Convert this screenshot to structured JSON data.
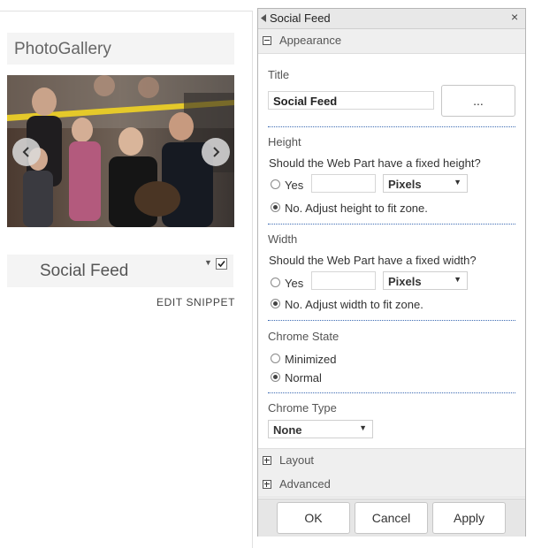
{
  "left": {
    "photo_gallery_title": "PhotoGallery",
    "social_feed_label": "Social Feed",
    "edit_snippet_label": "EDIT SNIPPET"
  },
  "panel": {
    "title": "Social Feed",
    "close_glyph": "×",
    "appearance_label": "Appearance",
    "title_field": {
      "label": "Title",
      "value": "Social Feed",
      "browse_button": "..."
    },
    "height": {
      "label": "Height",
      "question": "Should the Web Part have a fixed height?",
      "yes_label": "Yes",
      "unit": "Pixels",
      "no_label": "No. Adjust height to fit zone.",
      "selected": "no"
    },
    "width": {
      "label": "Width",
      "question": "Should the Web Part have a fixed width?",
      "yes_label": "Yes",
      "unit": "Pixels",
      "no_label": "No. Adjust width to fit zone.",
      "selected": "no"
    },
    "chrome_state": {
      "label": "Chrome State",
      "minimized_label": "Minimized",
      "normal_label": "Normal",
      "selected": "normal"
    },
    "chrome_type": {
      "label": "Chrome Type",
      "value": "None"
    },
    "layout_label": "Layout",
    "advanced_label": "Advanced",
    "buttons": {
      "ok": "OK",
      "cancel": "Cancel",
      "apply": "Apply"
    }
  },
  "icons": {
    "carousel_prev": "chevron-left-icon",
    "carousel_next": "chevron-right-icon",
    "close": "close-icon",
    "collapse": "triangle-left-icon"
  }
}
